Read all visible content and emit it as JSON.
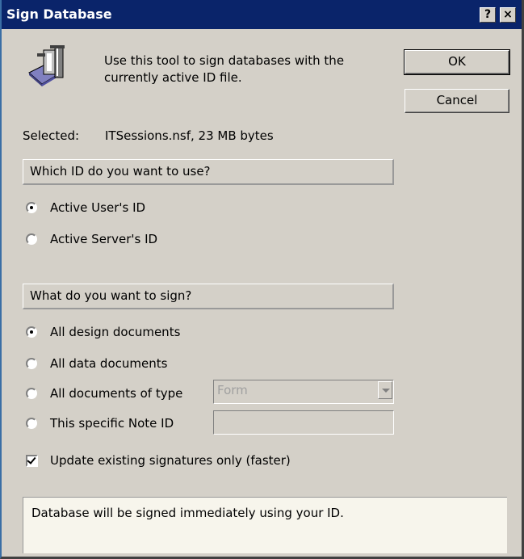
{
  "window": {
    "title": "Sign Database",
    "help_label": "?",
    "close_label": "×"
  },
  "header": {
    "icon": "sign-tool-icon",
    "description_line1": "Use this tool to sign databases with the",
    "description_line2": "currently active ID file."
  },
  "buttons": {
    "ok_label": "OK",
    "cancel_label": "Cancel"
  },
  "selected": {
    "label": "Selected:",
    "value": "ITSessions.nsf, 23 MB bytes"
  },
  "id_section": {
    "heading": "Which ID do you want to use?",
    "options": [
      {
        "label": "Active User's ID",
        "selected": true
      },
      {
        "label": "Active Server's ID",
        "selected": false
      }
    ]
  },
  "sign_section": {
    "heading": "What do you want to sign?",
    "options": [
      {
        "label": "All design documents",
        "selected": true
      },
      {
        "label": "All data documents",
        "selected": false
      },
      {
        "label": "All documents of type",
        "selected": false
      },
      {
        "label": "This specific Note ID",
        "selected": false
      }
    ],
    "doc_type_value": "Form",
    "note_id_value": ""
  },
  "update_checkbox": {
    "label": "Update existing signatures only (faster)",
    "checked": true
  },
  "status": {
    "message": "Database will be signed immediately using your ID."
  }
}
